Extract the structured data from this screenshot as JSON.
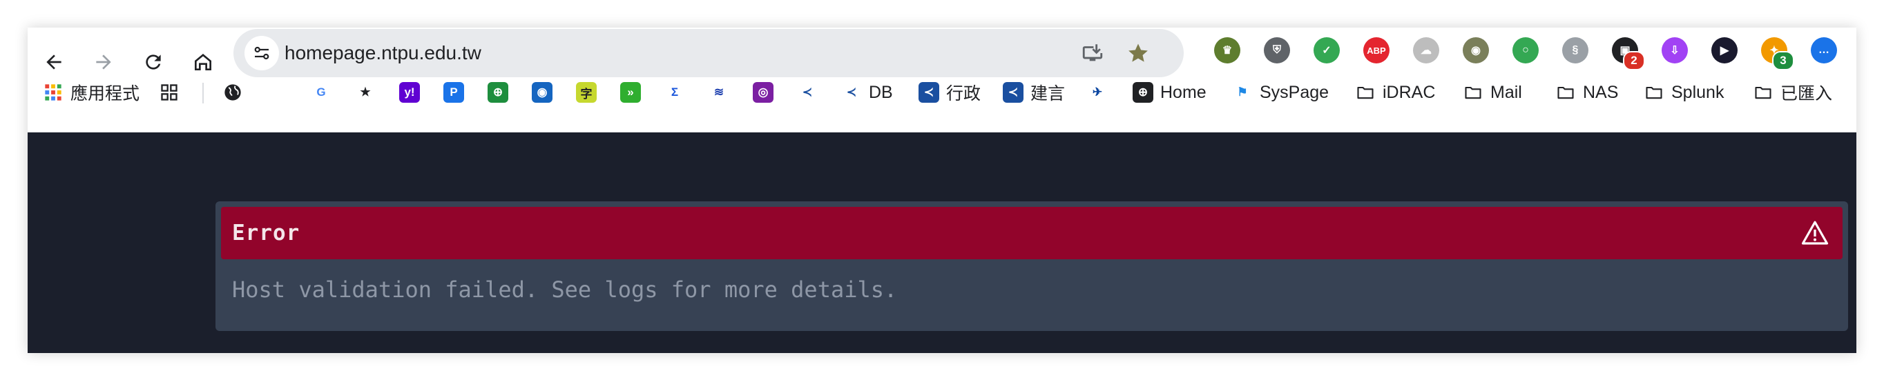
{
  "browser": {
    "url": "homepage.ntpu.edu.tw",
    "extensions": [
      {
        "icon": "crown-shield-icon",
        "color": "#5e7d2e"
      },
      {
        "icon": "bitwarden-icon",
        "color": "#5f6368"
      },
      {
        "icon": "shield-check-icon",
        "color": "#34a853"
      },
      {
        "icon": "adblock-plus-icon",
        "label": "ABP",
        "color": "#e4252f"
      },
      {
        "icon": "cloud-icon",
        "color": "#bdbdbd"
      },
      {
        "icon": "eye-cat-icon",
        "color": "#7a7f5a"
      },
      {
        "icon": "ring-icon",
        "color": "#34a853"
      },
      {
        "icon": "swirl-icon",
        "color": "#9aa0a6"
      },
      {
        "icon": "notifier-icon",
        "badge": "2",
        "badge_color": "#d93025",
        "color": "#202124"
      },
      {
        "icon": "download-box-icon",
        "color": "#a142f4"
      },
      {
        "icon": "play-circle-icon",
        "color": "#1a1a2e"
      },
      {
        "icon": "puzzle-person-icon",
        "badge": "3",
        "badge_color": "#1e8e3e",
        "color": "#f29900"
      },
      {
        "icon": "chat-bubble-icon",
        "color": "#1a73e8"
      }
    ]
  },
  "bookmarks": {
    "apps_label": "應用程式",
    "items": [
      {
        "label": "",
        "icon": "google-icon"
      },
      {
        "label": "",
        "icon": "star-icon"
      },
      {
        "label": "",
        "icon": "yahoo-icon"
      },
      {
        "label": "",
        "icon": "paypal-icon"
      },
      {
        "label": "",
        "icon": "restaurant-icon"
      },
      {
        "label": "",
        "icon": "target-icon"
      },
      {
        "label": "",
        "icon": "dictionary-icon"
      },
      {
        "label": "",
        "icon": "forward-icon"
      },
      {
        "label": "",
        "icon": "sigma-icon"
      },
      {
        "label": "",
        "icon": "stripe-icon"
      },
      {
        "label": "",
        "icon": "emblem-icon"
      },
      {
        "label": "",
        "icon": "ntpu-logo-icon"
      },
      {
        "label": "DB",
        "icon": "ntpu-logo-icon"
      },
      {
        "label": "行政",
        "icon": "ntpu-card-icon"
      },
      {
        "label": "建言",
        "icon": "ntpu-card-icon"
      },
      {
        "label": "",
        "icon": "swallow-icon"
      },
      {
        "label": "Home",
        "icon": "globe-icon"
      },
      {
        "label": "SysPage",
        "icon": "flag-icon"
      },
      {
        "label": "iDRAC",
        "icon": "folder-icon"
      },
      {
        "label": "Mail",
        "icon": "folder-icon"
      },
      {
        "label": "NAS",
        "icon": "folder-icon"
      },
      {
        "label": "Splunk",
        "icon": "folder-icon"
      },
      {
        "label": "已匯入",
        "icon": "folder-icon"
      }
    ]
  },
  "error": {
    "title": "Error",
    "message": "Host validation failed. See logs for more details."
  },
  "colors": {
    "page_bg": "#1b1f2c",
    "panel_bg": "#374254",
    "error_header": "#92042b"
  }
}
